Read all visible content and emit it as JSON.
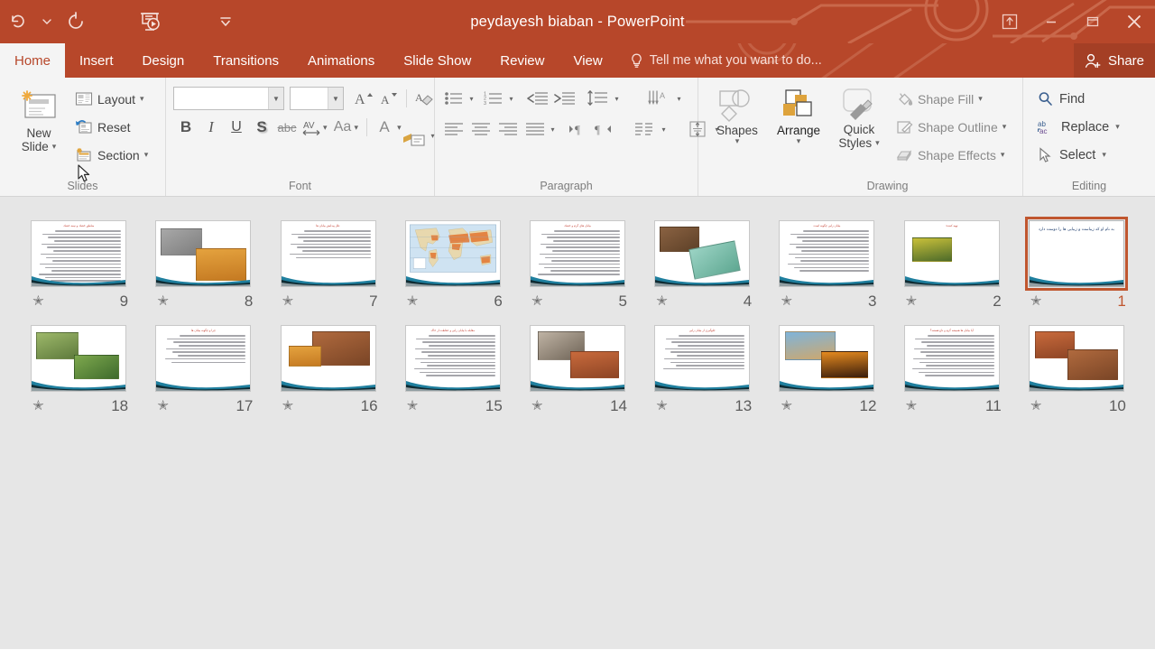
{
  "window": {
    "title": "peydayesh biaban - PowerPoint",
    "accent_color": "#b7472a",
    "quick_access": [
      {
        "name": "undo-icon",
        "label": "Undo"
      },
      {
        "name": "undo-dropdown-icon",
        "label": "Undo options"
      },
      {
        "name": "redo-icon",
        "label": "Redo"
      },
      {
        "name": "start-presentation-icon",
        "label": "Start From Beginning"
      },
      {
        "name": "customize-quick-access-icon",
        "label": "Customize Quick Access Toolbar"
      }
    ],
    "controls": [
      {
        "name": "ribbon-display-options-button",
        "label": "Ribbon Display Options"
      },
      {
        "name": "minimize-button",
        "label": "Minimize"
      },
      {
        "name": "restore-button",
        "label": "Restore Down"
      },
      {
        "name": "close-button",
        "label": "Close"
      }
    ]
  },
  "tabs": [
    {
      "label": "Home",
      "active": true
    },
    {
      "label": "Insert",
      "active": false
    },
    {
      "label": "Design",
      "active": false
    },
    {
      "label": "Transitions",
      "active": false
    },
    {
      "label": "Animations",
      "active": false
    },
    {
      "label": "Slide Show",
      "active": false
    },
    {
      "label": "Review",
      "active": false
    },
    {
      "label": "View",
      "active": false
    }
  ],
  "tell_me": {
    "placeholder": "Tell me what you want to do...",
    "icon": "lightbulb-icon"
  },
  "share": {
    "label": "Share",
    "icon": "person-add-icon"
  },
  "ribbon": {
    "groups": [
      {
        "label": "Slides",
        "new_slide": "New\nSlide",
        "new_slide_line1": "New",
        "new_slide_line2": "Slide",
        "items": [
          {
            "label": "Layout",
            "icon": "layout-icon",
            "has_caret": true
          },
          {
            "label": "Reset",
            "icon": "reset-icon",
            "has_caret": false
          },
          {
            "label": "Section",
            "icon": "section-icon",
            "has_caret": true
          }
        ]
      },
      {
        "label": "Font",
        "font_name_value": "",
        "font_name_placeholder": "",
        "font_size_value": "",
        "font_size_placeholder": "",
        "buttons": [
          {
            "name": "increase-font-size-button",
            "label": "A"
          },
          {
            "name": "decrease-font-size-button",
            "label": "A"
          },
          {
            "name": "clear-formatting-button",
            "label": "Clear All Formatting"
          },
          {
            "name": "bold-button",
            "label": "B"
          },
          {
            "name": "italic-button",
            "label": "I"
          },
          {
            "name": "underline-button",
            "label": "U"
          },
          {
            "name": "text-shadow-button",
            "label": "S"
          },
          {
            "name": "strikethrough-button",
            "label": "abc"
          },
          {
            "name": "character-spacing-button",
            "label": "AV"
          },
          {
            "name": "change-case-button",
            "label": "Aa"
          },
          {
            "name": "font-color-button",
            "label": "A"
          }
        ]
      },
      {
        "label": "Paragraph",
        "buttons": [
          {
            "name": "bullets-button",
            "label": "Bullets"
          },
          {
            "name": "numbering-button",
            "label": "Numbering"
          },
          {
            "name": "decrease-indent-button",
            "label": "Decrease List Level"
          },
          {
            "name": "increase-indent-button",
            "label": "Increase List Level"
          },
          {
            "name": "line-spacing-button",
            "label": "Line Spacing"
          },
          {
            "name": "text-direction-button",
            "label": "Text Direction"
          },
          {
            "name": "align-text-button",
            "label": "Align Text"
          },
          {
            "name": "convert-to-smartart-button",
            "label": "Convert to SmartArt"
          },
          {
            "name": "align-left-button",
            "label": "Align Left"
          },
          {
            "name": "align-center-button",
            "label": "Center"
          },
          {
            "name": "align-right-button",
            "label": "Align Right"
          },
          {
            "name": "justify-button",
            "label": "Justify"
          },
          {
            "name": "ltr-button",
            "label": "Left-to-Right Text Direction"
          },
          {
            "name": "rtl-button",
            "label": "Right-to-Left Text Direction"
          },
          {
            "name": "columns-button",
            "label": "Columns"
          }
        ]
      },
      {
        "label": "Drawing",
        "shapes_label": "Shapes",
        "arrange_label": "Arrange",
        "quick_styles_line1": "Quick",
        "quick_styles_line2": "Styles",
        "items": [
          {
            "label": "Shape Fill",
            "icon": "paint-bucket-icon",
            "has_caret": true
          },
          {
            "label": "Shape Outline",
            "icon": "pencil-outline-icon",
            "has_caret": true
          },
          {
            "label": "Shape Effects",
            "icon": "shape-effects-icon",
            "has_caret": true
          }
        ]
      },
      {
        "label": "Editing",
        "items": [
          {
            "label": "Find",
            "icon": "search-icon",
            "has_caret": false
          },
          {
            "label": "Replace",
            "icon": "replace-abac-icon",
            "has_caret": true
          },
          {
            "label": "Select",
            "icon": "pointer-icon",
            "has_caret": true
          }
        ]
      }
    ]
  },
  "slide_sorter": {
    "selected_slide": 1,
    "rows": [
      [
        {
          "number": "9",
          "kind": "text",
          "title": "مناطق خشک و نیمه خشک",
          "lines": 16,
          "starred": true
        },
        {
          "number": "8",
          "kind": "two-image",
          "title": "",
          "lines": 0,
          "starred": true
        },
        {
          "number": "7",
          "kind": "text",
          "title": "علل پیدایش بیابان ها",
          "lines": 9,
          "starred": true
        },
        {
          "number": "6",
          "kind": "map",
          "title": "",
          "lines": 0,
          "starred": true
        },
        {
          "number": "5",
          "kind": "text",
          "title": "بیابان های گرم و خشک",
          "lines": 14,
          "starred": true
        },
        {
          "number": "4",
          "kind": "two-image",
          "title": "",
          "lines": 0,
          "starred": true
        },
        {
          "number": "3",
          "kind": "text",
          "title": "بیابان زایی چگونه است",
          "lines": 13,
          "starred": true
        },
        {
          "number": "2",
          "kind": "one-image",
          "title": "تهیه کننده:",
          "lines": 0,
          "starred": true
        },
        {
          "number": "1",
          "kind": "title",
          "title": "به نام او که زیباست و زیبایی ها را دوست دارد",
          "lines": 0,
          "starred": true,
          "selected": true
        }
      ],
      [
        {
          "number": "18",
          "kind": "two-image",
          "title": "",
          "lines": 0,
          "starred": true
        },
        {
          "number": "17",
          "kind": "text",
          "title": "چرا و چگونه بیابان ها",
          "lines": 9,
          "starred": true
        },
        {
          "number": "16",
          "kind": "two-image",
          "title": "",
          "lines": 0,
          "starred": true
        },
        {
          "number": "15",
          "kind": "text",
          "title": "مقابله با بیابان زایی و حفاظت از خاک",
          "lines": 13,
          "starred": true
        },
        {
          "number": "14",
          "kind": "two-image",
          "title": "",
          "lines": 0,
          "starred": true
        },
        {
          "number": "13",
          "kind": "text",
          "title": "جلوگیری از بیابان زایی",
          "lines": 11,
          "starred": true
        },
        {
          "number": "12",
          "kind": "two-image",
          "title": "",
          "lines": 0,
          "starred": true
        },
        {
          "number": "11",
          "kind": "text",
          "title": "آیا بیابان ها همیشه گرم و داغ هستند؟",
          "lines": 13,
          "starred": true
        },
        {
          "number": "10",
          "kind": "two-image",
          "title": "",
          "lines": 0,
          "starred": true
        }
      ]
    ]
  }
}
